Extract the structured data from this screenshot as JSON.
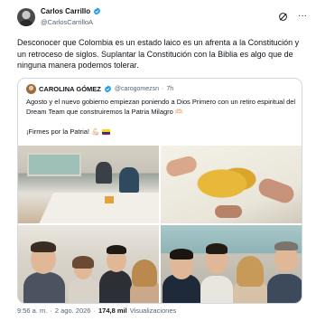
{
  "post": {
    "author": {
      "display_name": "Carlos Carrillo",
      "handle": "@CarlosCarrilloA",
      "verified": true
    },
    "text": "Desconocer que Colombia es un estado laico es un afrenta a la Constitución y un retroceso de siglos. Suplantar la Constitución con la Biblia es algo que de ninguna manera podemos tolerar.",
    "actions": {
      "grok_icon": "grok-icon",
      "more_icon": "more-icon",
      "more_label": "···"
    },
    "footer": {
      "time": "9:56 a. m.",
      "separator": "·",
      "date": "2 ago. 2026",
      "views_count": "174,8 mil",
      "views_label": "Visualizaciones"
    }
  },
  "quoted_post": {
    "author": {
      "display_name": "CAROLINA GÓMEZ",
      "handle": "@carogomezsn",
      "verified": true
    },
    "time_ago": "7h",
    "separator": "·",
    "text": "Agosto y el nuevo gobierno empiezan poniendo a Dios Primero con un retiro espiritual del Dream Team que construiremos la Patria Milagro 🫶🏻",
    "slogan": "¡Firmes por la Patria! 💪🏻",
    "photos": [
      "meeting-room-photo",
      "map-table-photo",
      "group-selfie-photo",
      "outdoor-selfie-photo"
    ]
  },
  "colors": {
    "text_primary": "#0f1419",
    "text_secondary": "#536471",
    "verified_blue": "#1d9bf0",
    "border": "#cfd9de"
  }
}
